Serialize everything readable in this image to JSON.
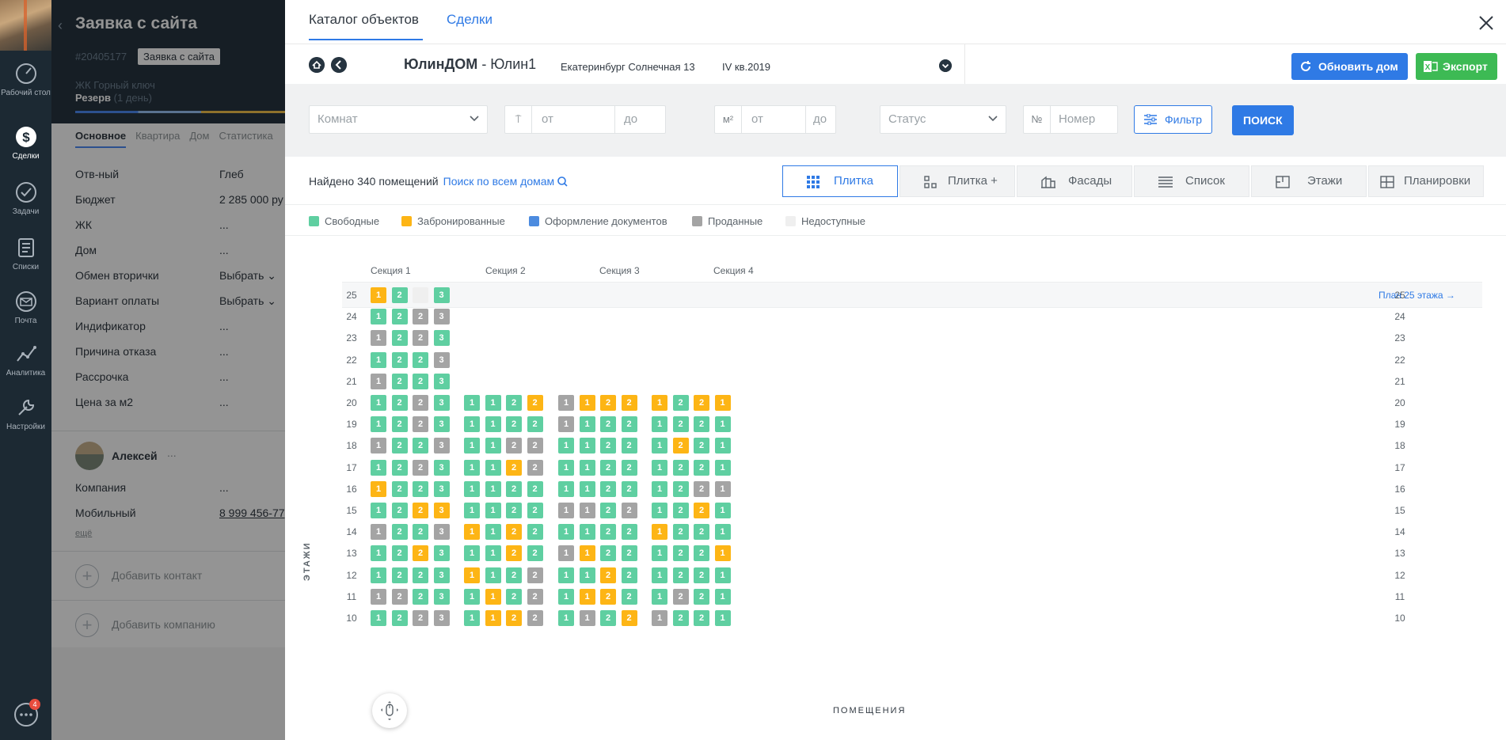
{
  "sidebar": {
    "items": [
      {
        "label": "Рабочий стол",
        "icon": "dashboard-icon"
      },
      {
        "label": "Сделки",
        "icon": "deals-icon"
      },
      {
        "label": "Задачи",
        "icon": "tasks-icon"
      },
      {
        "label": "Списки",
        "icon": "lists-icon"
      },
      {
        "label": "Почта",
        "icon": "mail-icon"
      },
      {
        "label": "Аналитика",
        "icon": "analytics-icon"
      },
      {
        "label": "Настройки",
        "icon": "settings-icon"
      }
    ],
    "chat_badge": "4"
  },
  "lead": {
    "title": "Заявка с сайта",
    "number": "#20405177",
    "tag": "Заявка с сайта",
    "complex": "ЖК Горный ключ",
    "stage": "Резерв",
    "stage_time": "(1 день)",
    "tabs": [
      "Основное",
      "Квартира",
      "Дом",
      "Статистика"
    ],
    "fields": [
      {
        "key": "Отв-ный",
        "value": "Глеб"
      },
      {
        "key": "Бюджет",
        "value": "2 285 000 ру"
      },
      {
        "key": "ЖК",
        "value": "..."
      },
      {
        "key": "Дом",
        "value": "..."
      },
      {
        "key": "Обмен вторички",
        "value": "Выбрать"
      },
      {
        "key": "Вариант оплаты",
        "value": "Выбрать"
      },
      {
        "key": "Индификатор",
        "value": "..."
      },
      {
        "key": "Причина отказа",
        "value": "..."
      },
      {
        "key": "Рассрочка",
        "value": "..."
      },
      {
        "key": "Цена за м2",
        "value": "..."
      }
    ],
    "contact": {
      "name": "Алексей",
      "dots": "...",
      "company_key": "Компания",
      "company_value": "...",
      "phone_key": "Мобильный",
      "phone_value": "8 999 456-77",
      "more": "ещё"
    },
    "add_contact": "Добавить контакт",
    "add_company": "Добавить компанию"
  },
  "main": {
    "tabs": [
      "Каталог объектов",
      "Сделки"
    ],
    "developer": "ЮлинДОМ",
    "house": " - Юлин1",
    "address": "Екатеринбург Солнечная 13",
    "quarter": "IV кв.2019",
    "refresh_button": "Обновить дом",
    "export_button": "Экспорт",
    "filters": {
      "rooms_placeholder": "Комнат",
      "floor_from": "от",
      "floor_to": "до",
      "area_unit": "м²",
      "area_from": "от",
      "area_to": "до",
      "status_placeholder": "Статус",
      "number_prefix": "№",
      "number_placeholder": "Номер",
      "filter_button": "Фильтр",
      "search_button": "ПОИСК"
    },
    "found_text": "Найдено 340 помещений",
    "search_all_link": "Поиск по всем домам",
    "views": [
      "Плитка",
      "Плитка +",
      "Фасады",
      "Список",
      "Этажи",
      "Планировки"
    ],
    "legend": [
      {
        "label": "Свободные",
        "color": "#5fcfa1"
      },
      {
        "label": "Забронированные",
        "color": "#fdb515"
      },
      {
        "label": "Оформление документов",
        "color": "#4c8bdf"
      },
      {
        "label": "Проданные",
        "color": "#a4a4a4"
      },
      {
        "label": "Недоступные",
        "color": "#efefef"
      }
    ],
    "floors_label": "ЭТАЖИ",
    "rooms_label": "ПОМЕЩЕНИЯ",
    "plan_link": "План 25 этажа",
    "plan_arrow": "→"
  },
  "chessboard": {
    "sections": [
      "Секция 1",
      "Секция 2",
      "Секция 3",
      "Секция 4"
    ],
    "status_colors": {
      "f": "#5fcfa1",
      "r": "#fdb515",
      "s": "#a4a4a4",
      "n": "#efefef"
    },
    "floors": [
      {
        "floor": 25,
        "sections": [
          [
            "1r",
            "2f",
            "n",
            "3f"
          ],
          [],
          [],
          []
        ]
      },
      {
        "floor": 24,
        "sections": [
          [
            "1f",
            "2f",
            "2s",
            "3s"
          ],
          [],
          [],
          []
        ]
      },
      {
        "floor": 23,
        "sections": [
          [
            "1s",
            "2f",
            "2s",
            "3f"
          ],
          [],
          [],
          []
        ]
      },
      {
        "floor": 22,
        "sections": [
          [
            "1f",
            "2f",
            "2f",
            "3s"
          ],
          [],
          [],
          []
        ]
      },
      {
        "floor": 21,
        "sections": [
          [
            "1s",
            "2f",
            "2f",
            "3f"
          ],
          [],
          [],
          []
        ]
      },
      {
        "floor": 20,
        "sections": [
          [
            "1f",
            "2f",
            "2s",
            "3f"
          ],
          [
            "1f",
            "1f",
            "2f",
            "2r"
          ],
          [
            "1s",
            "1r",
            "2r",
            "2r"
          ],
          [
            "1r",
            "2f",
            "2r",
            "1r"
          ]
        ]
      },
      {
        "floor": 19,
        "sections": [
          [
            "1f",
            "2f",
            "2s",
            "3f"
          ],
          [
            "1f",
            "1f",
            "2f",
            "2f"
          ],
          [
            "1s",
            "1f",
            "2f",
            "2f"
          ],
          [
            "1f",
            "2f",
            "2f",
            "1f"
          ]
        ]
      },
      {
        "floor": 18,
        "sections": [
          [
            "1s",
            "2f",
            "2f",
            "3s"
          ],
          [
            "1f",
            "1f",
            "2s",
            "2s"
          ],
          [
            "1f",
            "1f",
            "2f",
            "2f"
          ],
          [
            "1f",
            "2r",
            "2f",
            "1f"
          ]
        ]
      },
      {
        "floor": 17,
        "sections": [
          [
            "1f",
            "2f",
            "2s",
            "3f"
          ],
          [
            "1f",
            "1f",
            "2r",
            "2s"
          ],
          [
            "1f",
            "1f",
            "2f",
            "2f"
          ],
          [
            "1f",
            "2f",
            "2f",
            "1f"
          ]
        ]
      },
      {
        "floor": 16,
        "sections": [
          [
            "1r",
            "2f",
            "2f",
            "3f"
          ],
          [
            "1f",
            "1f",
            "2f",
            "2f"
          ],
          [
            "1f",
            "1f",
            "2f",
            "2f"
          ],
          [
            "1f",
            "2f",
            "2s",
            "1s"
          ]
        ]
      },
      {
        "floor": 15,
        "sections": [
          [
            "1f",
            "2f",
            "2r",
            "3r"
          ],
          [
            "1f",
            "1f",
            "2f",
            "2f"
          ],
          [
            "1s",
            "1s",
            "2f",
            "2s"
          ],
          [
            "1f",
            "2f",
            "2r",
            "1f"
          ]
        ]
      },
      {
        "floor": 14,
        "sections": [
          [
            "1s",
            "2f",
            "2f",
            "3s"
          ],
          [
            "1r",
            "1f",
            "2r",
            "2f"
          ],
          [
            "1f",
            "1f",
            "2f",
            "2f"
          ],
          [
            "1r",
            "2f",
            "2f",
            "1f"
          ]
        ]
      },
      {
        "floor": 13,
        "sections": [
          [
            "1f",
            "2f",
            "2r",
            "3f"
          ],
          [
            "1f",
            "1f",
            "2r",
            "2f"
          ],
          [
            "1s",
            "1r",
            "2f",
            "2f"
          ],
          [
            "1f",
            "2f",
            "2f",
            "1r"
          ]
        ]
      },
      {
        "floor": 12,
        "sections": [
          [
            "1f",
            "2f",
            "2f",
            "3f"
          ],
          [
            "1r",
            "1f",
            "2f",
            "2s"
          ],
          [
            "1f",
            "1f",
            "2r",
            "2f"
          ],
          [
            "1f",
            "2f",
            "2f",
            "1f"
          ]
        ]
      },
      {
        "floor": 11,
        "sections": [
          [
            "1s",
            "2s",
            "2f",
            "3f"
          ],
          [
            "1f",
            "1r",
            "2f",
            "2s"
          ],
          [
            "1f",
            "1r",
            "2r",
            "2f"
          ],
          [
            "1f",
            "2s",
            "2f",
            "1f"
          ]
        ]
      },
      {
        "floor": 10,
        "sections": [
          [
            "1f",
            "2f",
            "2s",
            "3s"
          ],
          [
            "1f",
            "1r",
            "2r",
            "2s"
          ],
          [
            "1f",
            "1s",
            "2f",
            "2r"
          ],
          [
            "1s",
            "2f",
            "2f",
            "1f"
          ]
        ]
      }
    ]
  }
}
